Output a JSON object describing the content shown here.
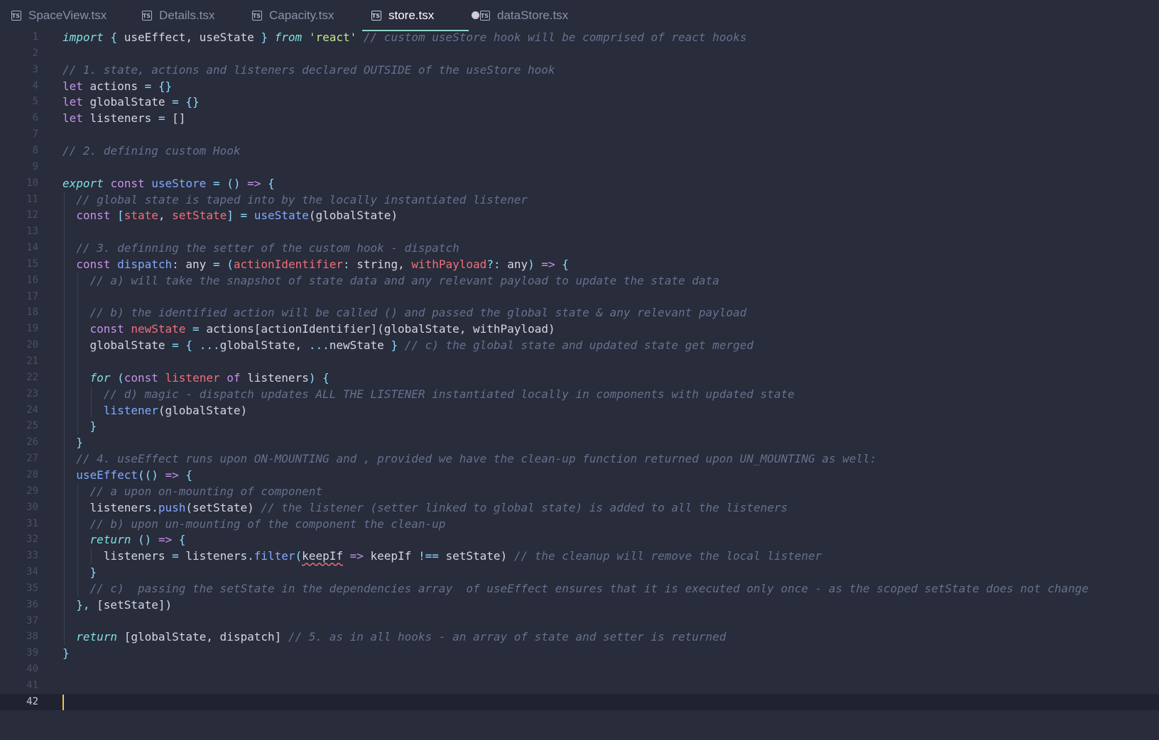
{
  "tabs": [
    {
      "label": "SpaceView.tsx",
      "icon": "typescript-file-icon",
      "badge": "TS"
    },
    {
      "label": "Details.tsx",
      "icon": "typescript-file-icon",
      "badge": "TS"
    },
    {
      "label": "Capacity.tsx",
      "icon": "typescript-file-icon",
      "badge": "TS"
    },
    {
      "label": "store.tsx",
      "icon": "typescript-file-icon",
      "badge": "TS",
      "active": true,
      "modified": true
    },
    {
      "label": "dataStore.tsx",
      "icon": "typescript-file-icon",
      "badge": "TS"
    }
  ],
  "editor": {
    "current_line": 42,
    "lines": [
      [
        [
          "ki",
          "import"
        ],
        [
          "t",
          " "
        ],
        [
          "o",
          "{"
        ],
        [
          "t",
          " useEffect, useState "
        ],
        [
          "o",
          "}"
        ],
        [
          "t",
          " "
        ],
        [
          "ki",
          "from"
        ],
        [
          "t",
          " "
        ],
        [
          "s",
          "'react'"
        ],
        [
          "t",
          " "
        ],
        [
          "c",
          "// custom useStore hook will be comprised of react hooks"
        ]
      ],
      [],
      [
        [
          "c",
          "// 1. state, actions and listeners declared OUTSIDE of the useStore hook"
        ]
      ],
      [
        [
          "k",
          "let"
        ],
        [
          "t",
          " actions "
        ],
        [
          "o",
          "="
        ],
        [
          "t",
          " "
        ],
        [
          "o",
          "{}"
        ]
      ],
      [
        [
          "k",
          "let"
        ],
        [
          "t",
          " globalState "
        ],
        [
          "o",
          "="
        ],
        [
          "t",
          " "
        ],
        [
          "o",
          "{}"
        ]
      ],
      [
        [
          "k",
          "let"
        ],
        [
          "t",
          " listeners "
        ],
        [
          "o",
          "="
        ],
        [
          "t",
          " []"
        ]
      ],
      [],
      [
        [
          "c",
          "// 2. defining custom Hook"
        ]
      ],
      [],
      [
        [
          "ki",
          "export"
        ],
        [
          "t",
          " "
        ],
        [
          "k",
          "const"
        ],
        [
          "t",
          " "
        ],
        [
          "f",
          "useStore"
        ],
        [
          "t",
          " "
        ],
        [
          "o",
          "="
        ],
        [
          "t",
          " "
        ],
        [
          "o",
          "()"
        ],
        [
          "t",
          " "
        ],
        [
          "k",
          "=>"
        ],
        [
          "t",
          " "
        ],
        [
          "o",
          "{"
        ]
      ],
      [
        [
          "t",
          "  "
        ],
        [
          "c",
          "// global state is taped into by the locally instantiated listener"
        ]
      ],
      [
        [
          "t",
          "  "
        ],
        [
          "k",
          "const"
        ],
        [
          "t",
          " "
        ],
        [
          "o",
          "["
        ],
        [
          "p",
          "state"
        ],
        [
          "t",
          ", "
        ],
        [
          "p",
          "setState"
        ],
        [
          "o",
          "]"
        ],
        [
          "t",
          " "
        ],
        [
          "o",
          "="
        ],
        [
          "t",
          " "
        ],
        [
          "f",
          "useState"
        ],
        [
          "t",
          "(globalState)"
        ]
      ],
      [],
      [
        [
          "t",
          "  "
        ],
        [
          "c",
          "// 3. definning the setter of the custom hook - dispatch"
        ]
      ],
      [
        [
          "t",
          "  "
        ],
        [
          "k",
          "const"
        ],
        [
          "t",
          " "
        ],
        [
          "f",
          "dispatch"
        ],
        [
          "o",
          ":"
        ],
        [
          "t",
          " any "
        ],
        [
          "o",
          "="
        ],
        [
          "t",
          " "
        ],
        [
          "o",
          "("
        ],
        [
          "p",
          "actionIdentifier"
        ],
        [
          "o",
          ":"
        ],
        [
          "t",
          " string, "
        ],
        [
          "p",
          "withPayload"
        ],
        [
          "o",
          "?:"
        ],
        [
          "t",
          " any"
        ],
        [
          "o",
          ")"
        ],
        [
          "t",
          " "
        ],
        [
          "k",
          "=>"
        ],
        [
          "t",
          " "
        ],
        [
          "o",
          "{"
        ]
      ],
      [
        [
          "t",
          "    "
        ],
        [
          "c",
          "// a) will take the snapshot of state data and any relevant payload to update the state data"
        ]
      ],
      [],
      [
        [
          "t",
          "    "
        ],
        [
          "c",
          "// b) the identified action will be called () and passed the global state & any relevant payload"
        ]
      ],
      [
        [
          "t",
          "    "
        ],
        [
          "k",
          "const"
        ],
        [
          "t",
          " "
        ],
        [
          "p",
          "newState"
        ],
        [
          "t",
          " "
        ],
        [
          "o",
          "="
        ],
        [
          "t",
          " actions[actionIdentifier](globalState, withPayload)"
        ]
      ],
      [
        [
          "t",
          "    globalState "
        ],
        [
          "o",
          "="
        ],
        [
          "t",
          " "
        ],
        [
          "o",
          "{"
        ],
        [
          "t",
          " "
        ],
        [
          "o",
          "..."
        ],
        [
          "t",
          "globalState, "
        ],
        [
          "o",
          "..."
        ],
        [
          "t",
          "newState "
        ],
        [
          "o",
          "}"
        ],
        [
          "t",
          " "
        ],
        [
          "c",
          "// c) the global state and updated state get merged"
        ]
      ],
      [],
      [
        [
          "t",
          "    "
        ],
        [
          "ki",
          "for"
        ],
        [
          "t",
          " "
        ],
        [
          "o",
          "("
        ],
        [
          "k",
          "const"
        ],
        [
          "t",
          " "
        ],
        [
          "p",
          "listener"
        ],
        [
          "t",
          " "
        ],
        [
          "k",
          "of"
        ],
        [
          "t",
          " listeners"
        ],
        [
          "o",
          ")"
        ],
        [
          "t",
          " "
        ],
        [
          "o",
          "{"
        ]
      ],
      [
        [
          "t",
          "      "
        ],
        [
          "c",
          "// d) magic - dispatch updates ALL THE LISTENER instantiated locally in components with updated state"
        ]
      ],
      [
        [
          "t",
          "      "
        ],
        [
          "f",
          "listener"
        ],
        [
          "t",
          "(globalState)"
        ]
      ],
      [
        [
          "t",
          "    "
        ],
        [
          "o",
          "}"
        ]
      ],
      [
        [
          "t",
          "  "
        ],
        [
          "o",
          "}"
        ]
      ],
      [
        [
          "t",
          "  "
        ],
        [
          "c",
          "// 4. useEffect runs upon ON-MOUNTING and , provided we have the clean-up function returned upon UN_MOUNTING as well:"
        ]
      ],
      [
        [
          "t",
          "  "
        ],
        [
          "f",
          "useEffect"
        ],
        [
          "o",
          "(()"
        ],
        [
          "t",
          " "
        ],
        [
          "k",
          "=>"
        ],
        [
          "t",
          " "
        ],
        [
          "o",
          "{"
        ]
      ],
      [
        [
          "t",
          "    "
        ],
        [
          "c",
          "// a upon on-mounting of component"
        ]
      ],
      [
        [
          "t",
          "    listeners"
        ],
        [
          "o",
          "."
        ],
        [
          "f",
          "push"
        ],
        [
          "t",
          "(setState) "
        ],
        [
          "c",
          "// the listener (setter linked to global state) is added to all the listeners"
        ]
      ],
      [
        [
          "t",
          "    "
        ],
        [
          "c",
          "// b) upon un-mounting of the component the clean-up"
        ]
      ],
      [
        [
          "t",
          "    "
        ],
        [
          "ki",
          "return"
        ],
        [
          "t",
          " "
        ],
        [
          "o",
          "()"
        ],
        [
          "t",
          " "
        ],
        [
          "k",
          "=>"
        ],
        [
          "t",
          " "
        ],
        [
          "o",
          "{"
        ]
      ],
      [
        [
          "t",
          "      listeners "
        ],
        [
          "o",
          "="
        ],
        [
          "t",
          " listeners"
        ],
        [
          "o",
          "."
        ],
        [
          "f",
          "filter"
        ],
        [
          "o",
          "("
        ],
        [
          "sq",
          "keepIf"
        ],
        [
          "t",
          " "
        ],
        [
          "k",
          "=>"
        ],
        [
          "t",
          " keepIf "
        ],
        [
          "o",
          "!=="
        ],
        [
          "t",
          " setState) "
        ],
        [
          "c",
          "// the cleanup will remove the local listener"
        ]
      ],
      [
        [
          "t",
          "    "
        ],
        [
          "o",
          "}"
        ]
      ],
      [
        [
          "t",
          "    "
        ],
        [
          "c",
          "// c)  passing the setState in the dependencies array  of useEffect ensures that it is executed only once - as the scoped setState does not change"
        ]
      ],
      [
        [
          "t",
          "  "
        ],
        [
          "o",
          "},"
        ],
        [
          "t",
          " [setState])"
        ]
      ],
      [],
      [
        [
          "t",
          "  "
        ],
        [
          "ki",
          "return"
        ],
        [
          "t",
          " [globalState, dispatch] "
        ],
        [
          "c",
          "// 5. as in all hooks - an array of state and setter is returned"
        ]
      ],
      [
        [
          "o",
          "}"
        ]
      ],
      [],
      [],
      []
    ]
  }
}
